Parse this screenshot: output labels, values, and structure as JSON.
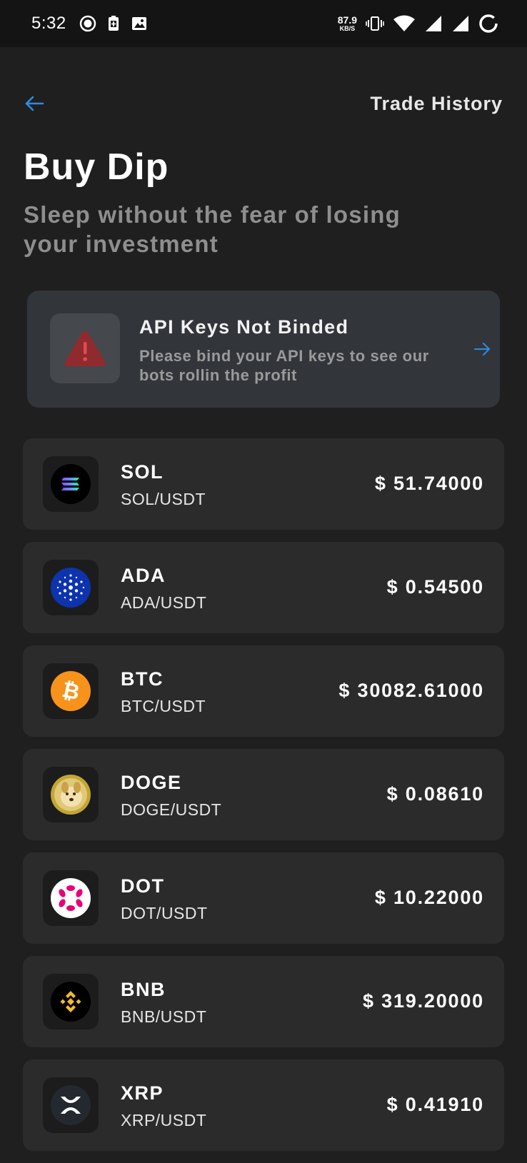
{
  "status_bar": {
    "time": "5:32",
    "net_speed_value": "87.9",
    "net_speed_unit": "KB/S"
  },
  "nav": {
    "trade_history_label": "Trade History"
  },
  "page": {
    "title": "Buy Dip",
    "subtitle": "Sleep without the fear of losing your investment"
  },
  "alert": {
    "title": "API Keys Not Binded",
    "message": "Please bind your API keys to see our bots rollin the profit"
  },
  "colors": {
    "accent_blue": "#2f8be0",
    "warning_red": "#8f2b2f",
    "card_bg": "#2b2b2b",
    "background": "#1f1f1f"
  },
  "coins": [
    {
      "symbol": "SOL",
      "pair": "SOL/USDT",
      "price": "$ 51.74000",
      "icon": "solana-icon"
    },
    {
      "symbol": "ADA",
      "pair": "ADA/USDT",
      "price": "$ 0.54500",
      "icon": "cardano-icon"
    },
    {
      "symbol": "BTC",
      "pair": "BTC/USDT",
      "price": "$ 30082.61000",
      "icon": "bitcoin-icon"
    },
    {
      "symbol": "DOGE",
      "pair": "DOGE/USDT",
      "price": "$ 0.08610",
      "icon": "dogecoin-icon"
    },
    {
      "symbol": "DOT",
      "pair": "DOT/USDT",
      "price": "$ 10.22000",
      "icon": "polkadot-icon"
    },
    {
      "symbol": "BNB",
      "pair": "BNB/USDT",
      "price": "$ 319.20000",
      "icon": "bnb-icon"
    },
    {
      "symbol": "XRP",
      "pair": "XRP/USDT",
      "price": "$ 0.41910",
      "icon": "xrp-icon"
    }
  ]
}
